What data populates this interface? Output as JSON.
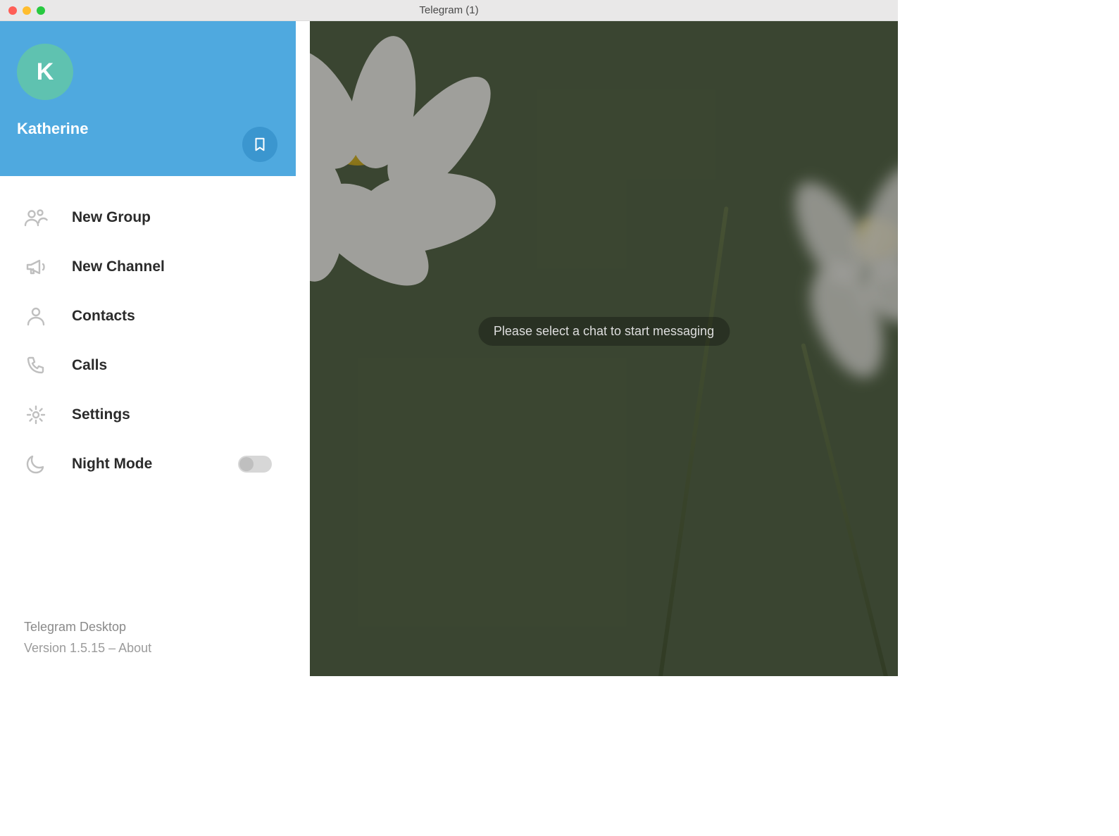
{
  "window": {
    "title": "Telegram (1)"
  },
  "profile": {
    "initial": "K",
    "name": "Katherine"
  },
  "menu": {
    "items": [
      {
        "label": "New Group"
      },
      {
        "label": "New Channel"
      },
      {
        "label": "Contacts"
      },
      {
        "label": "Calls"
      },
      {
        "label": "Settings"
      },
      {
        "label": "Night Mode"
      }
    ]
  },
  "footer": {
    "app": "Telegram Desktop",
    "version_line": "Version 1.5.15 – About"
  },
  "chat": {
    "placeholder": "Please select a chat to start messaging"
  }
}
